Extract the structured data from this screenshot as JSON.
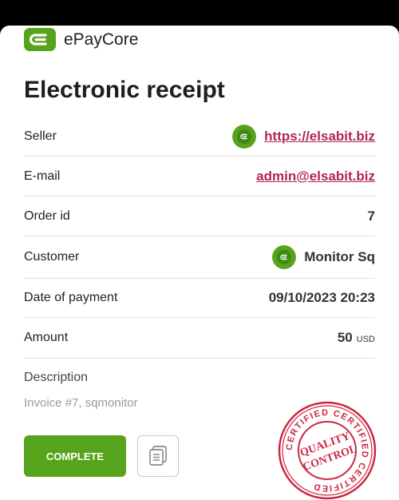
{
  "brand": {
    "name": "ePayCore",
    "icon": "epaycore-logo-icon"
  },
  "page": {
    "title": "Electronic receipt"
  },
  "rows": [
    {
      "label": "Seller",
      "value": "https://elsabit.biz",
      "type": "link",
      "avatar": "seller-avatar-icon"
    },
    {
      "label": "E-mail",
      "value": "admin@elsabit.biz",
      "type": "link"
    },
    {
      "label": "Order id",
      "value": "7"
    },
    {
      "label": "Customer",
      "value": "Monitor Sq",
      "avatar": "customer-avatar-icon"
    },
    {
      "label": "Date of payment",
      "value": "09/10/2023 20:23"
    },
    {
      "label": "Amount",
      "value": "50",
      "unit": "USD"
    }
  ],
  "description": {
    "label": "Description",
    "text": "Invoice #7, sqmonitor"
  },
  "actions": {
    "complete_label": "COMPLETE",
    "copy_icon": "copy-icon"
  },
  "stamp": {
    "line1": "QUALITY",
    "line2": "CONTROL",
    "ring": "CERTIFIED CERTIFIED CERTIFIED"
  },
  "colors": {
    "accent": "#57a31c",
    "link": "#b2245b",
    "stamp": "#c8102e"
  }
}
